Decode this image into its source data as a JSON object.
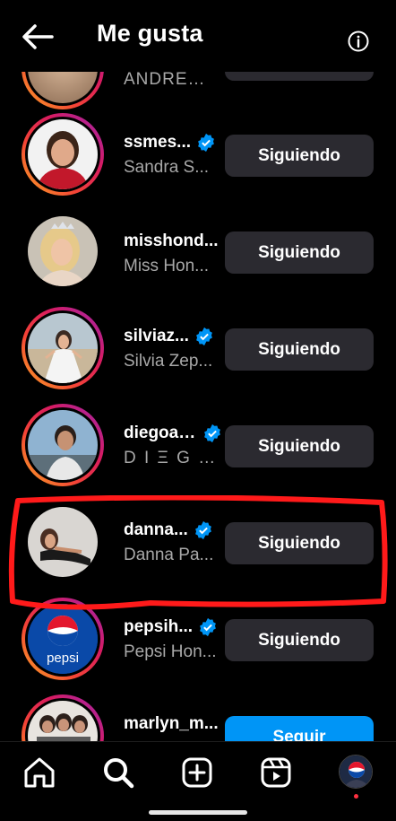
{
  "header": {
    "title": "Me gusta",
    "back_icon": "arrow-left-icon",
    "info_icon": "info-icon"
  },
  "colors": {
    "background": "#000000",
    "button_following": "#2b2a30",
    "button_follow": "#0095f6",
    "verified": "#0095f6",
    "highlight": "#ff1a1a",
    "ring_gradient": [
      "#f9a825",
      "#f44336",
      "#d81b60",
      "#9c27b0"
    ]
  },
  "users": [
    {
      "username": "",
      "fullname": "ANDRES J...",
      "button": ""
    },
    {
      "username": "ssmes...",
      "fullname": "Sandra S...",
      "button": "Siguiendo",
      "verified": true
    },
    {
      "username": "misshond...",
      "fullname": "Miss Hon...",
      "button": "Siguiendo",
      "verified": false
    },
    {
      "username": "silviaz...",
      "fullname": "Silvia Zep...",
      "button": "Siguiendo",
      "verified": true
    },
    {
      "username": "diegoal...",
      "fullname": "D I Ξ G O ...",
      "button": "Siguiendo",
      "verified": true
    },
    {
      "username": "danna...",
      "fullname": "Danna Pa...",
      "button": "Siguiendo",
      "verified": true
    },
    {
      "username": "pepsih...",
      "fullname": "Pepsi Hon...",
      "button": "Siguiendo",
      "verified": true,
      "logo_text": "pepsi"
    },
    {
      "username": "marlyn_m...",
      "fullname": "",
      "button": "Seguir",
      "verified": false
    }
  ],
  "nav": [
    "home-icon",
    "search-icon",
    "create-icon",
    "reels-icon",
    "profile-avatar"
  ]
}
